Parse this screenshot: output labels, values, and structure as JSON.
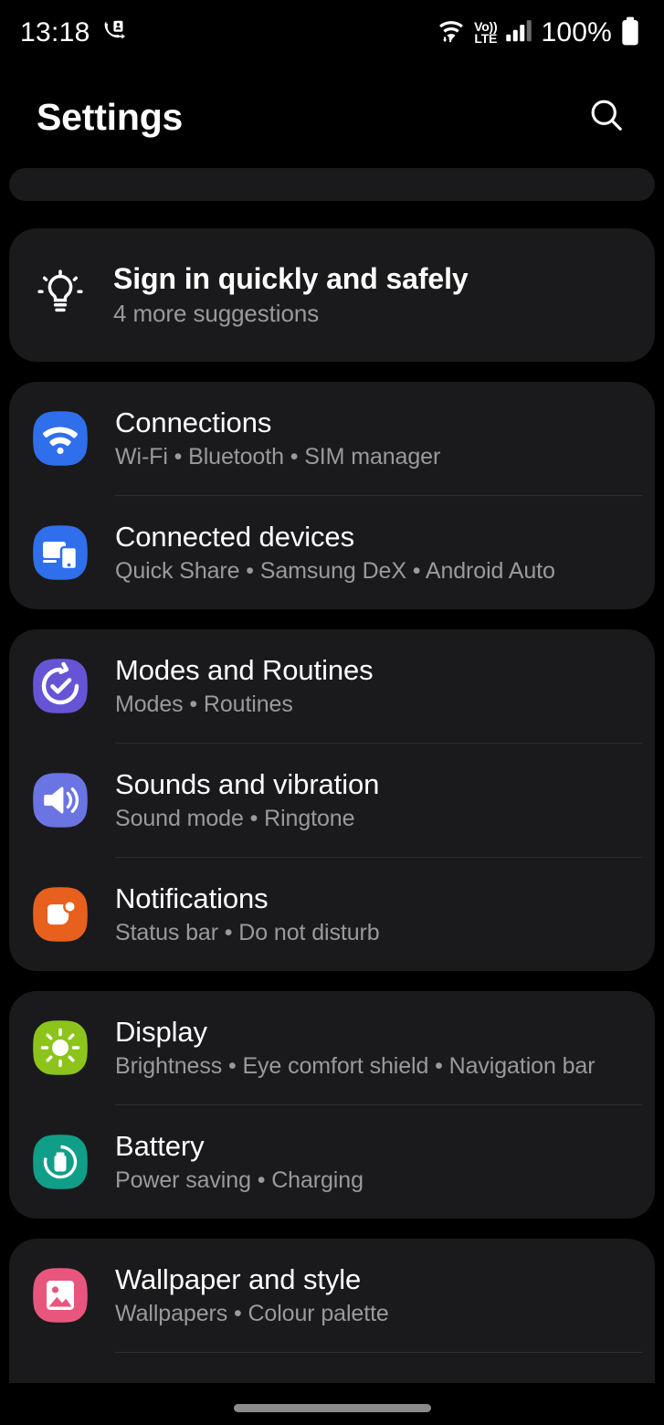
{
  "status_bar": {
    "time": "13:18",
    "call_icon": "call-forwarding-icon",
    "wifi_icon": "wifi-icon",
    "volte_top": "Vo))",
    "volte_bottom": "LTE",
    "signal_icon": "signal-bars-icon",
    "battery_text": "100%",
    "battery_icon": "battery-full-icon"
  },
  "header": {
    "title": "Settings",
    "search_icon": "search-icon"
  },
  "suggestion": {
    "icon": "lightbulb-icon",
    "title": "Sign in quickly and safely",
    "subtitle": "4 more suggestions"
  },
  "groups": [
    {
      "id": "connections-group",
      "items": [
        {
          "name": "connections",
          "title": "Connections",
          "subtitle": "Wi-Fi  •  Bluetooth  •  SIM manager",
          "icon": "wifi-icon",
          "icon_color": "#2f6fec"
        },
        {
          "name": "connected-devices",
          "title": "Connected devices",
          "subtitle": "Quick Share  •  Samsung DeX  •  Android Auto",
          "icon": "connected-devices-icon",
          "icon_color": "#2f6fec"
        }
      ]
    },
    {
      "id": "modes-sounds-notifications-group",
      "items": [
        {
          "name": "modes-and-routines",
          "title": "Modes and Routines",
          "subtitle": "Modes  •  Routines",
          "icon": "check-circle-refresh-icon",
          "icon_color": "#6555d6"
        },
        {
          "name": "sounds-and-vibration",
          "title": "Sounds and vibration",
          "subtitle": "Sound mode  •  Ringtone",
          "icon": "speaker-icon",
          "icon_color": "#6a74e2"
        },
        {
          "name": "notifications",
          "title": "Notifications",
          "subtitle": "Status bar  •  Do not disturb",
          "icon": "notification-bubble-icon",
          "icon_color": "#e8601d"
        }
      ]
    },
    {
      "id": "display-battery-group",
      "items": [
        {
          "name": "display",
          "title": "Display",
          "subtitle": "Brightness  •  Eye comfort shield  •  Navigation bar",
          "icon": "brightness-sun-icon",
          "icon_color": "#8cc41c"
        },
        {
          "name": "battery",
          "title": "Battery",
          "subtitle": "Power saving  •  Charging",
          "icon": "battery-icon",
          "icon_color": "#109e88"
        }
      ]
    },
    {
      "id": "wallpaper-group",
      "items": [
        {
          "name": "wallpaper-and-style",
          "title": "Wallpaper and style",
          "subtitle": "Wallpapers  •  Colour palette",
          "icon": "image-picture-icon",
          "icon_color": "#e8567e"
        }
      ]
    }
  ]
}
